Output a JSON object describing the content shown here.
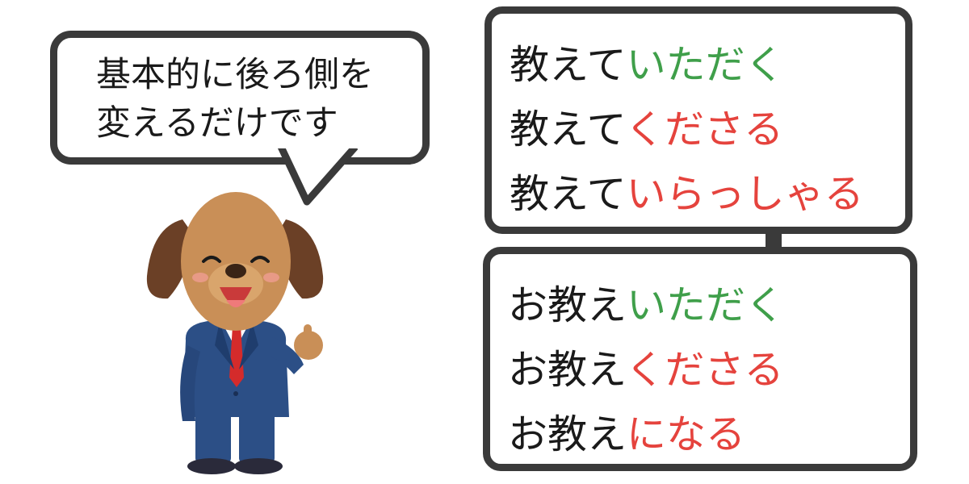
{
  "speech_bubble": {
    "line1": "基本的に後ろ側を",
    "line2": "変えるだけです"
  },
  "top_box": {
    "lines": [
      {
        "stem": "教えて",
        "ending": "いただく",
        "ending_color": "#3f9f4a"
      },
      {
        "stem": "教えて",
        "ending": "くださる",
        "ending_color": "#e5433d"
      },
      {
        "stem": "教えて",
        "ending": "いらっしゃる",
        "ending_color": "#e5433d"
      }
    ]
  },
  "bottom_box": {
    "lines": [
      {
        "stem": "お教え",
        "ending": "いただく",
        "ending_color": "#3f9f4a"
      },
      {
        "stem": "お教え",
        "ending": "くださる",
        "ending_color": "#e5433d"
      },
      {
        "stem": "お教え",
        "ending": "になる",
        "ending_color": "#e5433d"
      }
    ]
  },
  "colors": {
    "outline": "#3a3a3a",
    "green": "#3f9f4a",
    "red": "#e5433d"
  },
  "illustration": {
    "character": "dog-in-business-suit-illustration"
  }
}
